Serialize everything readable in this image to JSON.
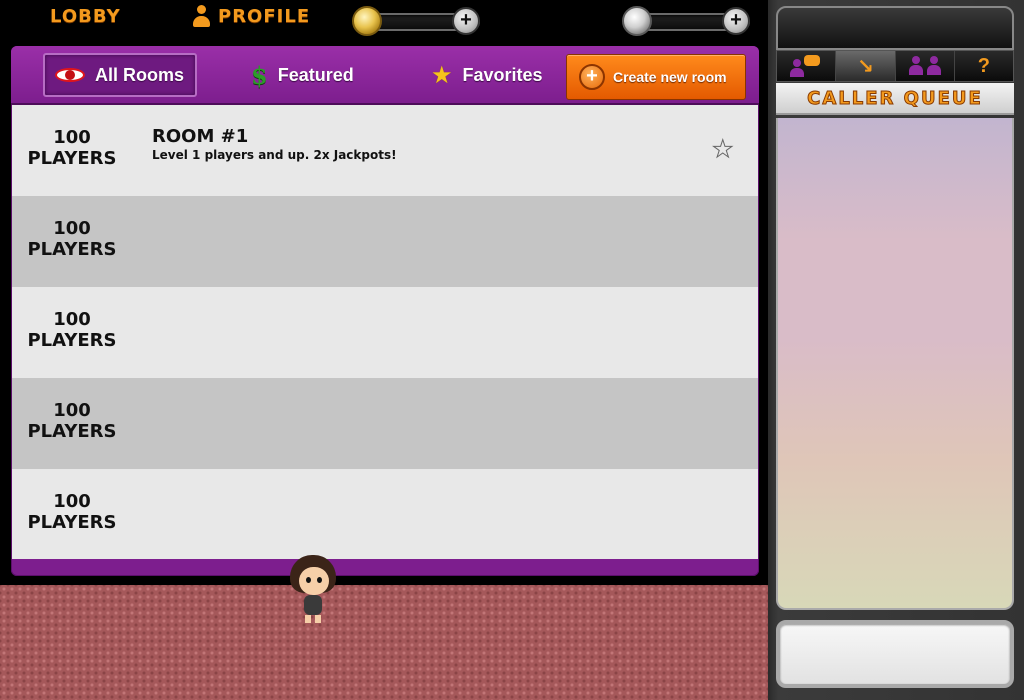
{
  "nav": {
    "lobby_label": "LOBBY",
    "profile_label": "PROFILE"
  },
  "currency": {
    "coins": {
      "icon": "gold-coin-icon",
      "add_icon": "plus-icon",
      "plus_glyph": "+"
    },
    "silver": {
      "icon": "silver-coin-icon",
      "add_icon": "plus-icon",
      "plus_glyph": "+"
    }
  },
  "tabs": [
    {
      "label": "All Rooms",
      "icon": "eye-icon",
      "active": true
    },
    {
      "label": "Featured",
      "icon": "dollar-icon",
      "glyph": "$"
    },
    {
      "label": "Favorites",
      "icon": "star-icon",
      "glyph": "★"
    }
  ],
  "create_room": {
    "label": "Create new room",
    "plus_glyph": "+"
  },
  "rooms": [
    {
      "players_count": "100",
      "players_label": "PLAYERS",
      "name": "ROOM #1",
      "description": "Level 1 players and up.  2x Jackpots!",
      "favorite_glyph": "★"
    },
    {
      "players_count": "100",
      "players_label": "PLAYERS"
    },
    {
      "players_count": "100",
      "players_label": "PLAYERS"
    },
    {
      "players_count": "100",
      "players_label": "PLAYERS"
    },
    {
      "players_count": "100",
      "players_label": "PLAYERS"
    }
  ],
  "side": {
    "tabs": [
      {
        "icon": "chat-icon"
      },
      {
        "icon": "lever-icon",
        "glyph": "↘",
        "active": true
      },
      {
        "icon": "friends-icon"
      },
      {
        "icon": "help-icon",
        "glyph": "?"
      }
    ],
    "title": "CALLER QUEUE"
  },
  "colors": {
    "accent_orange": "#f39a1e",
    "panel_purple": "#7d1e8e",
    "create_button": "#ff7a0d",
    "row_light": "#e8e8e8",
    "row_dark": "#c5c5c5"
  }
}
